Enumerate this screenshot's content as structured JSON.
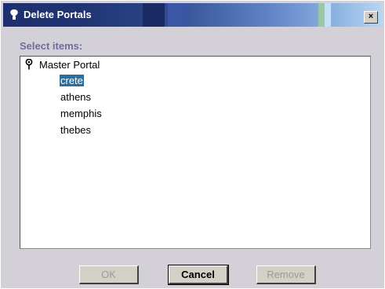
{
  "window": {
    "title": "Delete Portals",
    "close_label": "×",
    "icon": "portal-pin-icon"
  },
  "tree": {
    "label": "Select items:",
    "root": {
      "label": "Master Portal",
      "icon": "portal-pin-icon"
    },
    "children": [
      {
        "label": "crete",
        "selected": true
      },
      {
        "label": "athens",
        "selected": false
      },
      {
        "label": "memphis",
        "selected": false
      },
      {
        "label": "thebes",
        "selected": false
      }
    ]
  },
  "buttons": {
    "ok": {
      "label": "OK",
      "enabled": false
    },
    "cancel": {
      "label": "Cancel",
      "enabled": true
    },
    "remove": {
      "label": "Remove",
      "enabled": false
    }
  },
  "colors": {
    "selection": "#2b6f9c",
    "label_text": "#6e6f96",
    "title_text": "#ffffff"
  }
}
